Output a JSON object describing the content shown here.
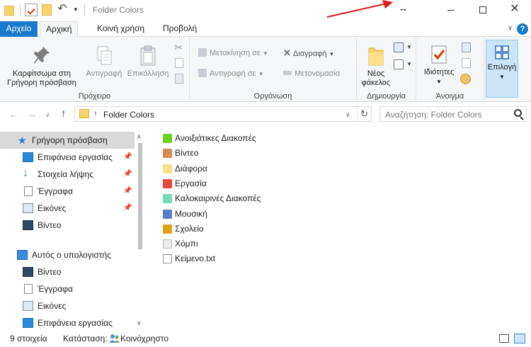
{
  "window": {
    "title": "Folder Colors",
    "cursor_glyph": "↔"
  },
  "ribbon_tabs": [
    {
      "label": "Αρχείο"
    },
    {
      "label": "Αρχική"
    },
    {
      "label": "Κοινή χρήση"
    },
    {
      "label": "Προβολή"
    }
  ],
  "ribbon": {
    "clipboard": {
      "group_label": "Πρόχειρο",
      "pin_label_1": "Καρφίτσωμα στη",
      "pin_label_2": "Γρήγορη πρόσβαση",
      "copy_label": "Αντιγραφή",
      "paste_label": "Επικόλληση"
    },
    "organize": {
      "group_label": "Οργάνωση",
      "move_to": "Μετακίνηση σε",
      "copy_to": "Αντιγραφή σε",
      "delete": "Διαγραφή",
      "rename": "Μετονομασία"
    },
    "new": {
      "group_label": "Δημιουργία",
      "new_folder_1": "Νέος",
      "new_folder_2": "φάκελος"
    },
    "open": {
      "group_label": "Άνοιγμα",
      "properties": "Ιδιότητες"
    },
    "select": {
      "select_label": "Επιλογή"
    }
  },
  "nav": {
    "path": "Folder Colors",
    "search_placeholder": "Αναζήτηση: Folder Colors"
  },
  "sidebar": {
    "items": [
      {
        "label": "Γρήγορη πρόσβαση",
        "icon": "star-icon"
      },
      {
        "label": "Επιφάνεια εργασίας",
        "icon": "desktop-icon",
        "pinned": true
      },
      {
        "label": "Στοιχεία λήψης",
        "icon": "download-icon",
        "pinned": true
      },
      {
        "label": "Έγγραφα",
        "icon": "documents-icon",
        "pinned": true
      },
      {
        "label": "Εικόνες",
        "icon": "pictures-icon",
        "pinned": true
      },
      {
        "label": "Βίντεο",
        "icon": "videos-icon"
      },
      {
        "label": "Αυτός ο υπολογιστής",
        "icon": "computer-icon"
      },
      {
        "label": "Βίντεο",
        "icon": "videos-icon"
      },
      {
        "label": "Έγγραφα",
        "icon": "documents-icon"
      },
      {
        "label": "Εικόνες",
        "icon": "pictures-icon"
      },
      {
        "label": "Επιφάνεια εργασίας",
        "icon": "desktop-icon"
      }
    ]
  },
  "files": [
    {
      "name": "Ανοιξιάτικες Διακοπές",
      "color": "#6fcf1a"
    },
    {
      "name": "Βίντεο",
      "color": "#d88b4e"
    },
    {
      "name": "Διάφορα",
      "color": "#f7e08a"
    },
    {
      "name": "Εργασία",
      "color": "#e2493b"
    },
    {
      "name": "Καλοκαιρινές Διακοπές",
      "color": "#6fdcb4"
    },
    {
      "name": "Μουσική",
      "color": "#5a7cc9"
    },
    {
      "name": "Σχολείο",
      "color": "#e0a21a"
    },
    {
      "name": "Χόμπι",
      "color": "#ececec"
    },
    {
      "name": "Κείμενο.txt",
      "color": "#ffffff"
    }
  ],
  "status": {
    "count": "9 στοιχεία",
    "state_label": "Κατάσταση:",
    "state_value": "Κοινόχρηστο"
  },
  "colors": {
    "accent": "#1979ca",
    "annotation_arrow": "#e0191b"
  }
}
